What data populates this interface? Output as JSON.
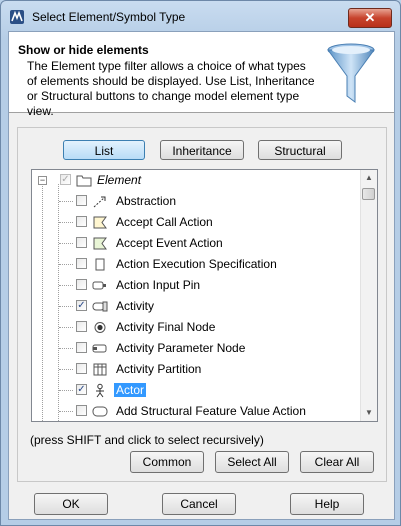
{
  "window": {
    "title": "Select Element/Symbol Type",
    "close_glyph": "✕"
  },
  "header": {
    "title": "Show or hide elements",
    "description": "The Element type filter allows a choice of what types of elements should be displayed. Use List, Inheritance or Structural buttons to change model element type view."
  },
  "view_buttons": {
    "list": "List",
    "inheritance": "Inheritance",
    "structural": "Structural"
  },
  "tree": {
    "root": {
      "label": "Element",
      "checked": true
    },
    "items": [
      {
        "label": "Abstraction",
        "checked": false,
        "icon": "abstraction-icon"
      },
      {
        "label": "Accept Call Action",
        "checked": false,
        "icon": "accept-call-action-icon"
      },
      {
        "label": "Accept Event Action",
        "checked": false,
        "icon": "accept-event-action-icon"
      },
      {
        "label": "Action Execution Specification",
        "checked": false,
        "icon": "action-execution-specification-icon"
      },
      {
        "label": "Action Input Pin",
        "checked": false,
        "icon": "action-input-pin-icon"
      },
      {
        "label": "Activity",
        "checked": true,
        "icon": "activity-icon"
      },
      {
        "label": "Activity Final Node",
        "checked": false,
        "icon": "activity-final-node-icon"
      },
      {
        "label": "Activity Parameter Node",
        "checked": false,
        "icon": "activity-parameter-node-icon"
      },
      {
        "label": "Activity Partition",
        "checked": false,
        "icon": "activity-partition-icon"
      },
      {
        "label": "Actor",
        "checked": true,
        "icon": "actor-icon",
        "selected": true
      },
      {
        "label": "Add Structural Feature Value Action",
        "checked": false,
        "icon": "add-structural-feature-value-action-icon"
      }
    ]
  },
  "hint": "(press SHIFT and click to select recursively)",
  "group_buttons": {
    "common": "Common",
    "select_all": "Select All",
    "clear_all": "Clear All"
  },
  "footer": {
    "ok": "OK",
    "cancel": "Cancel",
    "help": "Help"
  },
  "check_glyph": "✓"
}
